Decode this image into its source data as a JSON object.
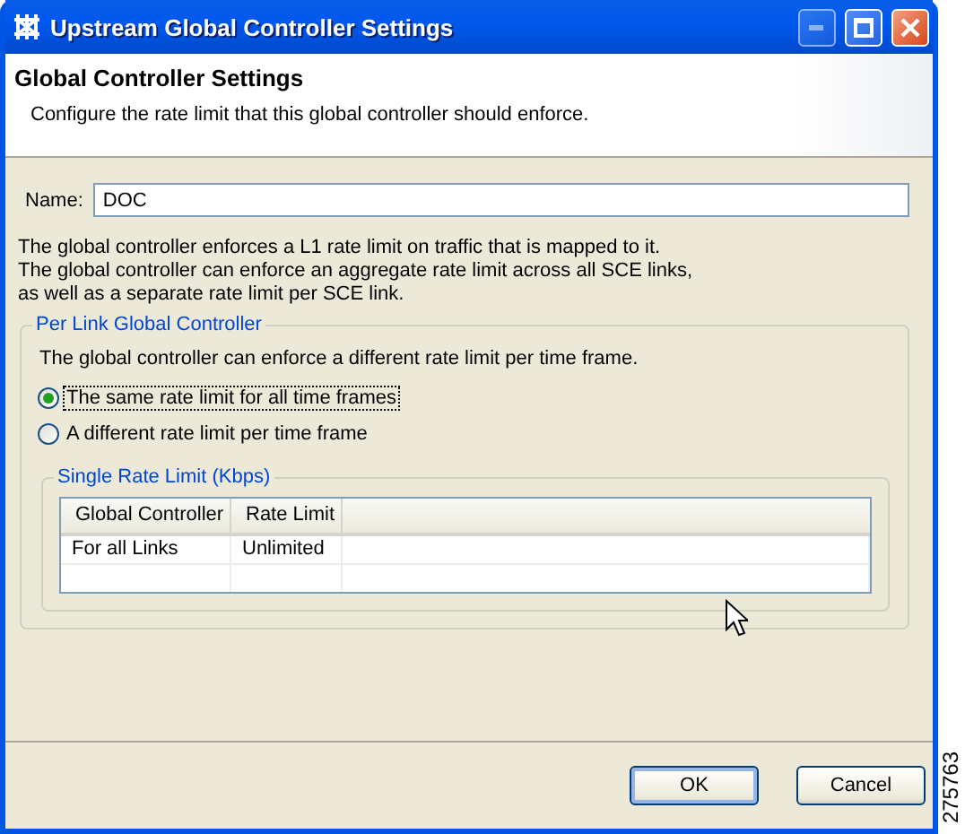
{
  "window": {
    "title": "Upstream Global Controller Settings"
  },
  "header": {
    "title": "Global Controller Settings",
    "description": "Configure the rate limit that this global controller should enforce."
  },
  "name_field": {
    "label": "Name:",
    "value": "DOC"
  },
  "info": [
    "The global controller enforces a L1 rate limit on traffic that is mapped to it.",
    "The global controller can enforce an aggregate rate limit across all SCE links,",
    "as well as a separate rate limit per SCE link."
  ],
  "per_link_group": {
    "title": "Per Link Global Controller",
    "description": "The global controller can enforce a different rate limit per time frame.",
    "options": [
      {
        "label": "The same rate limit for all time frames",
        "selected": true,
        "focused": true
      },
      {
        "label": "A different rate limit per time frame",
        "selected": false,
        "focused": false
      }
    ],
    "single_rate_group": {
      "title": "Single Rate Limit (Kbps)",
      "table": {
        "columns": [
          "Global Controller",
          "Rate Limit"
        ],
        "rows": [
          [
            "For all Links",
            "Unlimited"
          ]
        ]
      }
    }
  },
  "buttons": [
    {
      "label": "OK",
      "default": true
    },
    {
      "label": "Cancel",
      "default": false
    }
  ],
  "figure_id": "275763"
}
